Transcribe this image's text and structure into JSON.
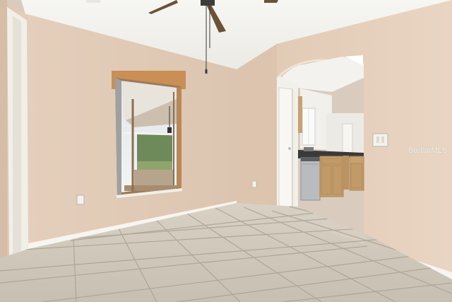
{
  "photo": {
    "watermark": "StellarMLS"
  },
  "colors": {
    "wall": "#e3cdb9",
    "wall_shadow": "#d6bfaa",
    "ceiling": "#f4f3ef",
    "tile": "#cfc7b9",
    "grout": "#a9a091",
    "baseboard": "#f7f5f0",
    "window_frame": "#c98f55",
    "cabinet": "#c8a170",
    "countertop": "#3a3a3a"
  }
}
